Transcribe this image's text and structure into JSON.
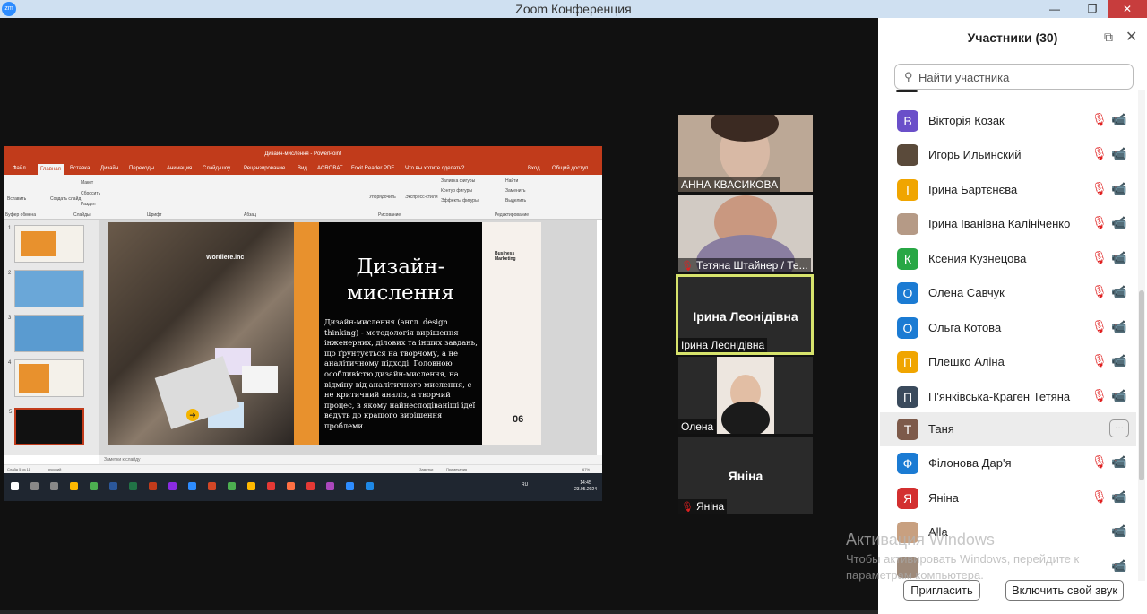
{
  "window": {
    "title": "Zoom Конференция",
    "logo": "zm",
    "minimize": "—",
    "restore": "❐",
    "close": "✕"
  },
  "presentation": {
    "title": "Дизайн-мислення - PowerPoint",
    "menu": [
      "Файл",
      "Главная",
      "Вставка",
      "Дизайн",
      "Переходы",
      "Анимация",
      "Слайд-шоу",
      "Рецензирование",
      "Вид",
      "ACROBAT",
      "Foxit Reader PDF"
    ],
    "tell_me": "Что вы хотите сделать?",
    "sign_in": "Вход",
    "share": "Общий доступ",
    "ribbon_groups": [
      "Буфер обмена",
      "Слайды",
      "Шрифт",
      "Абзац",
      "Рисование",
      "Редактирование"
    ],
    "ribbon_items": [
      "Вставить",
      "Создать слайд",
      "Макет",
      "Сбросить",
      "Раздел",
      "Упорядочить",
      "Экспресс-стили",
      "Заливка фигуры",
      "Контур фигуры",
      "Эффекты фигуры",
      "Найти",
      "Заменить",
      "Выделить"
    ],
    "slide_numbers": [
      "1",
      "2",
      "3",
      "4",
      "5"
    ],
    "notes": "Заметки к слайду",
    "status_left": "Слайд 5 из 11",
    "status_lang": "русский",
    "status_right": [
      "Заметки",
      "Примечания",
      "67%"
    ],
    "slide": {
      "brand": "Wordiere.inc",
      "heading": "Дизайн-мислення",
      "body": "Дизайн-мислення (англ. design thinking) - методологія вирішення інженерних, ділових та інших завдань, що ґрунтується на творчому, а не аналітичному підході. Головною особливістю дизайн-мислення, на відміну від аналітичного мислення, є не критичний аналіз, а творчий процес, в якому найнесподіваніші ідеї ведуть до кращого вирішення проблеми.",
      "tag": "Business Marketing",
      "number": "06"
    },
    "taskbar_time": "14:45",
    "taskbar_date": "23.05.2024",
    "taskbar_lang": "RU"
  },
  "video_tiles": [
    {
      "name": "АННА КВАСИКОВА",
      "muted": false,
      "center": ""
    },
    {
      "name": "Тетяна Штайнер / Те...",
      "muted": true,
      "center": ""
    },
    {
      "name": "Ірина Леонідівна",
      "muted": false,
      "center": "Ірина Леонідівна",
      "speaking": true
    },
    {
      "name": "Олена",
      "muted": false,
      "center": ""
    },
    {
      "name": "Яніна",
      "muted": true,
      "center": "Яніна"
    }
  ],
  "participants_panel": {
    "title": "Участники (30)",
    "search_placeholder": "Найти участника",
    "participants": [
      {
        "name": "Вікторія Козак",
        "initial": "В",
        "color": "#6a4fc9",
        "mic": "off",
        "video": "off"
      },
      {
        "name": "Игорь Ильинский",
        "initial": "",
        "color": "#5a4a3a",
        "mic": "off",
        "video": "off",
        "photo": true
      },
      {
        "name": "Ірина Бартєнєва",
        "initial": "І",
        "color": "#f0a500",
        "mic": "off",
        "video": "on"
      },
      {
        "name": "Ірина Іванівна Калініченко",
        "initial": "",
        "color": "#b59a86",
        "mic": "off",
        "video": "off",
        "photo": true
      },
      {
        "name": "Ксения Кузнецова",
        "initial": "К",
        "color": "#28a745",
        "mic": "off",
        "video": "off"
      },
      {
        "name": "Олена Савчук",
        "initial": "О",
        "color": "#1b7bd3",
        "mic": "off",
        "video": "off"
      },
      {
        "name": "Ольга Котова",
        "initial": "О",
        "color": "#1b7bd3",
        "mic": "off",
        "video": "off"
      },
      {
        "name": "Плешко Аліна",
        "initial": "П",
        "color": "#f0a500",
        "mic": "off",
        "video": "off"
      },
      {
        "name": "П'янківська-Краген Тетяна",
        "initial": "П",
        "color": "#3a4a5c",
        "mic": "off",
        "video": "off"
      },
      {
        "name": "Таня",
        "initial": "Т",
        "color": "#7d5a4a",
        "mic": "none",
        "video": "none",
        "hover": true,
        "more": "···"
      },
      {
        "name": "Філонова Дар'я",
        "initial": "Ф",
        "color": "#1b7bd3",
        "mic": "off",
        "video": "off"
      },
      {
        "name": "Яніна",
        "initial": "Я",
        "color": "#d32f2f",
        "mic": "off",
        "video": "off"
      },
      {
        "name": "Alla",
        "initial": "",
        "color": "#c8a080",
        "mic": "none",
        "video": "off",
        "photo": true
      }
    ],
    "invite_label": "Пригласить",
    "unmute_label": "Включить свой звук"
  },
  "watermark": {
    "title": "Активация Windows",
    "text": "Чтобы активировать Windows, перейдите к параметрам компьютера."
  },
  "icons": {
    "search": "search-icon",
    "mic_off": "mic-off-icon",
    "video_off": "video-off-icon",
    "video_on": "video-on-icon",
    "popout": "popout-icon",
    "close": "close-icon"
  }
}
